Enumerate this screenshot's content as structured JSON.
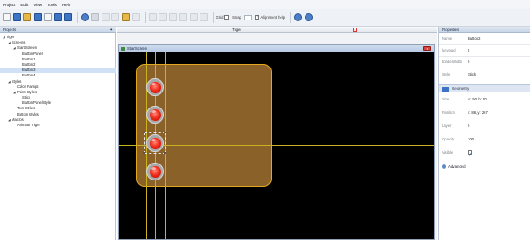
{
  "menu": [
    "Project",
    "Edit",
    "View",
    "Tools",
    "Help"
  ],
  "toolbar": {
    "grid_label": "Grid",
    "snap_label": "Snap",
    "alignment_label": "Alignment help"
  },
  "projects": {
    "title": "Projects",
    "pin": "✦",
    "tree": [
      {
        "label": "Tiger",
        "indent": 0,
        "arrow": "◢"
      },
      {
        "label": "Screens",
        "indent": 1,
        "arrow": "◢"
      },
      {
        "label": "StartScreen",
        "indent": 2,
        "arrow": "◢"
      },
      {
        "label": "ButtonPanel",
        "indent": 3,
        "arrow": ""
      },
      {
        "label": "Button1",
        "indent": 3,
        "arrow": ""
      },
      {
        "label": "Button2",
        "indent": 3,
        "arrow": ""
      },
      {
        "label": "Button3",
        "indent": 3,
        "arrow": "",
        "selected": true
      },
      {
        "label": "Button4",
        "indent": 3,
        "arrow": ""
      },
      {
        "label": "Styles",
        "indent": 1,
        "arrow": "◢"
      },
      {
        "label": "Color Ramps",
        "indent": 2,
        "arrow": ""
      },
      {
        "label": "Paint Styles",
        "indent": 2,
        "arrow": "◢"
      },
      {
        "label": "Stick",
        "indent": 3,
        "arrow": ""
      },
      {
        "label": "ButtonPanelStyle",
        "indent": 3,
        "arrow": ""
      },
      {
        "label": "Text Styles",
        "indent": 2,
        "arrow": ""
      },
      {
        "label": "Button Styles",
        "indent": 2,
        "arrow": ""
      },
      {
        "label": "Macros",
        "indent": 1,
        "arrow": "◢"
      },
      {
        "label": "Animate Tiger",
        "indent": 2,
        "arrow": ""
      }
    ]
  },
  "editor": {
    "tab_title": "Tiger",
    "tab_close": "x",
    "window_title": "StartScreen",
    "window_close": "x"
  },
  "properties": {
    "title": "Properties",
    "rows": [
      {
        "label": "Name",
        "value": "Button2"
      },
      {
        "label": "ldevoald",
        "value": "5"
      },
      {
        "label": "borderWidth",
        "value": "0"
      },
      {
        "label": "Style",
        "value": "Stick"
      }
    ],
    "geometry_label": "Geometry",
    "geometry_rows": [
      {
        "label": "Size",
        "value": "w: 50, h: 50"
      },
      {
        "label": "Position",
        "value": "x: 86, y: 267"
      },
      {
        "label": "Layer",
        "value": "0"
      },
      {
        "label": "Opacity",
        "value": "100"
      },
      {
        "label": "Visible",
        "value": ""
      }
    ],
    "advanced_label": "Advanced"
  },
  "colors": {
    "canvas": "#000000",
    "panel_fill": "#8a6128",
    "panel_border": "#e3a81e",
    "guide": "#c8b31e",
    "button_red": "#f22b1b"
  }
}
